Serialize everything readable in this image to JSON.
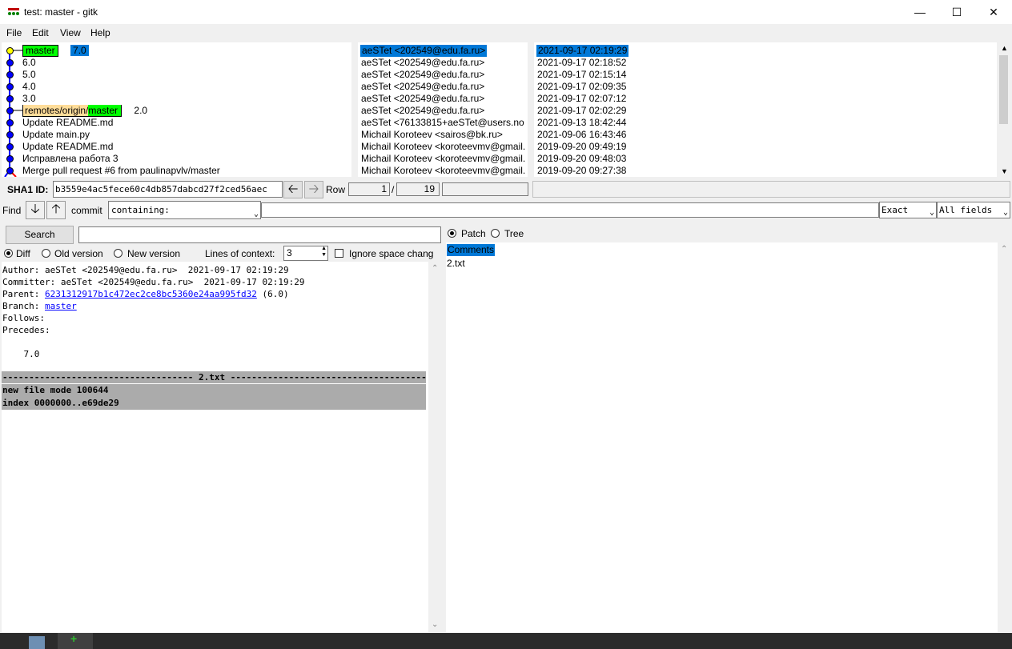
{
  "window": {
    "title": "test: master - gitk"
  },
  "menu": [
    "File",
    "Edit",
    "View",
    "Help"
  ],
  "commits": [
    {
      "refs": [
        {
          "text": "master",
          "color": "green"
        },
        {
          "text": "7.0",
          "color": "blue"
        }
      ],
      "message": "",
      "author": "aeSTet <202549@edu.fa.ru>",
      "date": "2021-09-17 02:19:29",
      "selected": true
    },
    {
      "refs": [],
      "message": "6.0",
      "author": "aeSTet <202549@edu.fa.ru>",
      "date": "2021-09-17 02:18:52"
    },
    {
      "refs": [],
      "message": "5.0",
      "author": "aeSTet <202549@edu.fa.ru>",
      "date": "2021-09-17 02:15:14"
    },
    {
      "refs": [],
      "message": "4.0",
      "author": "aeSTet <202549@edu.fa.ru>",
      "date": "2021-09-17 02:09:35"
    },
    {
      "refs": [],
      "message": "3.0",
      "author": "aeSTet <202549@edu.fa.ru>",
      "date": "2021-09-17 02:07:12"
    },
    {
      "refs": [
        {
          "text": "remotes/origin/",
          "color": "tan"
        },
        {
          "text": "master",
          "color": "green"
        }
      ],
      "message": "2.0",
      "author": "aeSTet <202549@edu.fa.ru>",
      "date": "2021-09-17 02:02:29"
    },
    {
      "refs": [],
      "message": "Update README.md",
      "author": "aeSTet <76133815+aeSTet@users.no",
      "date": "2021-09-13 18:42:44"
    },
    {
      "refs": [],
      "message": "Update main.py",
      "author": "Michail Koroteev <sairos@bk.ru>",
      "date": "2021-09-06 16:43:46"
    },
    {
      "refs": [],
      "message": "Update README.md",
      "author": "Michail Koroteev <koroteevmv@gmail.",
      "date": "2019-09-20 09:49:19"
    },
    {
      "refs": [],
      "message": "Исправлена работа 3",
      "author": "Michail Koroteev <koroteevmv@gmail.",
      "date": "2019-09-20 09:48:03"
    },
    {
      "refs": [],
      "message": "Merge pull request #6 from paulinapvlv/master",
      "author": "Michail Koroteev <koroteevmv@gmail.",
      "date": "2019-09-20 09:27:38"
    }
  ],
  "sha": {
    "label": "SHA1 ID:",
    "value": "b3559e4ac5fece60c4db857dabcd27f2ced56aec",
    "row_label": "Row",
    "row_current": "1",
    "row_sep": "/",
    "row_total": "19"
  },
  "find": {
    "label": "Find",
    "type_label": "commit",
    "mode": "containing:",
    "match": "Exact",
    "fields": "All fields"
  },
  "search": {
    "button": "Search",
    "value": ""
  },
  "diff_options": {
    "diff": "Diff",
    "old": "Old version",
    "new": "New version",
    "context_label": "Lines of context:",
    "context_value": "3",
    "ignore_space": "Ignore space chang"
  },
  "detail": {
    "author_label": "Author:",
    "author": "aeSTet <202549@edu.fa.ru>  2021-09-17 02:19:29",
    "committer_label": "Committer:",
    "committer": "aeSTet <202549@edu.fa.ru>  2021-09-17 02:19:29",
    "parent_label": "Parent:",
    "parent_hash": "6231312917b1c472ec2ce8bc5360e24aa995fd32",
    "parent_tag": "(6.0)",
    "branch_label": "Branch:",
    "branch": "master",
    "follows": "Follows:",
    "precedes": "Precedes:",
    "message": "    7.0",
    "file_header": "------------------------------------ 2.txt -------------------------------------",
    "mode_line": "new file mode 100644",
    "index_line": "index 0000000..e69de29"
  },
  "files_view": {
    "patch": "Patch",
    "tree": "Tree",
    "items": [
      "Comments",
      "2.txt"
    ]
  },
  "colors": {
    "selection": "#0078d7",
    "ref_green": "#00ff00",
    "ref_tan": "#ffdd99",
    "node_blue": "#0000ff",
    "node_yellow": "#ffff00"
  }
}
